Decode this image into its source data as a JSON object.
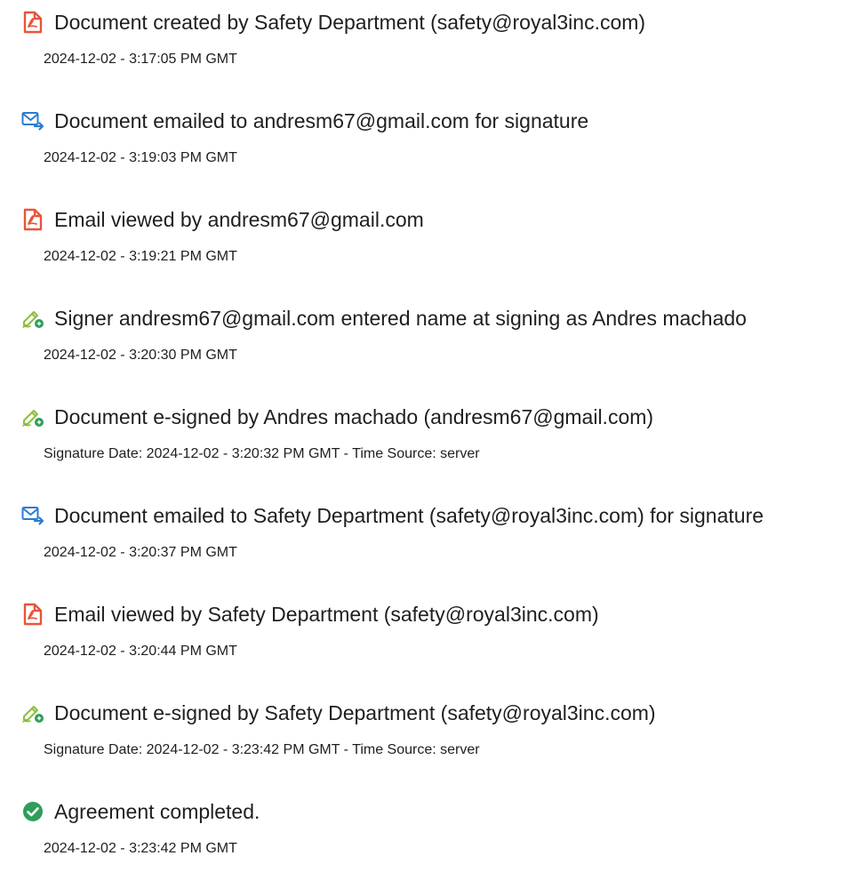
{
  "events": [
    {
      "icon": "pdf-document-icon",
      "title": "Document created by Safety Department (safety@royal3inc.com)",
      "detail": "2024-12-02 - 3:17:05 PM GMT"
    },
    {
      "icon": "email-send-icon",
      "title": "Document emailed to andresm67@gmail.com for signature",
      "detail": "2024-12-02 - 3:19:03 PM GMT"
    },
    {
      "icon": "pdf-document-icon",
      "title": "Email viewed by andresm67@gmail.com",
      "detail": "2024-12-02 - 3:19:21 PM GMT"
    },
    {
      "icon": "signature-pen-icon",
      "title": "Signer andresm67@gmail.com entered name at signing as Andres machado",
      "detail": "2024-12-02 - 3:20:30 PM GMT"
    },
    {
      "icon": "signature-pen-icon",
      "title": "Document e-signed by Andres machado (andresm67@gmail.com)",
      "detail": "Signature Date: 2024-12-02 - 3:20:32 PM GMT - Time Source: server"
    },
    {
      "icon": "email-send-icon",
      "title": "Document emailed to Safety Department (safety@royal3inc.com) for signature",
      "detail": "2024-12-02 - 3:20:37 PM GMT"
    },
    {
      "icon": "pdf-document-icon",
      "title": "Email viewed by Safety Department (safety@royal3inc.com)",
      "detail": "2024-12-02 - 3:20:44 PM GMT"
    },
    {
      "icon": "signature-pen-icon",
      "title": "Document e-signed by Safety Department (safety@royal3inc.com)",
      "detail": "Signature Date: 2024-12-02 - 3:23:42 PM GMT - Time Source: server"
    },
    {
      "icon": "check-circle-icon",
      "title": "Agreement completed.",
      "detail": "2024-12-02 - 3:23:42 PM GMT"
    }
  ],
  "colors": {
    "pdf_icon": "#e8553a",
    "email_icon": "#2b7ccf",
    "signature_icon": "#8bbf3b",
    "complete_icon": "#2e9e5b"
  }
}
